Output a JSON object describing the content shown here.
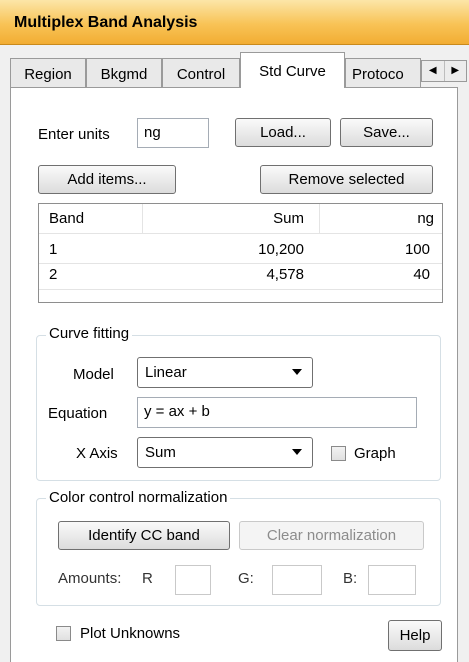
{
  "title": "Multiplex Band Analysis",
  "tabs": [
    "Region",
    "Bkgmd",
    "Control",
    "Std Curve",
    "Protoco"
  ],
  "tab_scroll": {
    "left": "◀",
    "right": "▶"
  },
  "units": {
    "label": "Enter units",
    "value": "ng"
  },
  "buttons": {
    "load": "Load...",
    "save": "Save...",
    "add_items": "Add items...",
    "remove_selected": "Remove selected",
    "help": "Help"
  },
  "table": {
    "headers": [
      "Band",
      "Sum",
      "ng"
    ],
    "rows": [
      [
        "1",
        "10,200",
        "100"
      ],
      [
        "2",
        "4,578",
        "40"
      ]
    ]
  },
  "curve_fitting": {
    "legend": "Curve fitting",
    "model_label": "Model",
    "model_value": "Linear",
    "equation_label": "Equation",
    "equation_value": "y = ax + b",
    "xaxis_label": "X Axis",
    "xaxis_value": "Sum",
    "graph_label": "Graph"
  },
  "color_control": {
    "legend": "Color control normalization",
    "identify": "Identify CC band",
    "clear": "Clear normalization",
    "amounts_label": "Amounts:",
    "r_label": "R",
    "g_label": "G:",
    "b_label": "B:"
  },
  "plot_unknowns": "Plot Unknowns",
  "colors": {
    "title_bar": "#f8c356",
    "panel": "#ffffff",
    "window": "#f0f0f0"
  }
}
